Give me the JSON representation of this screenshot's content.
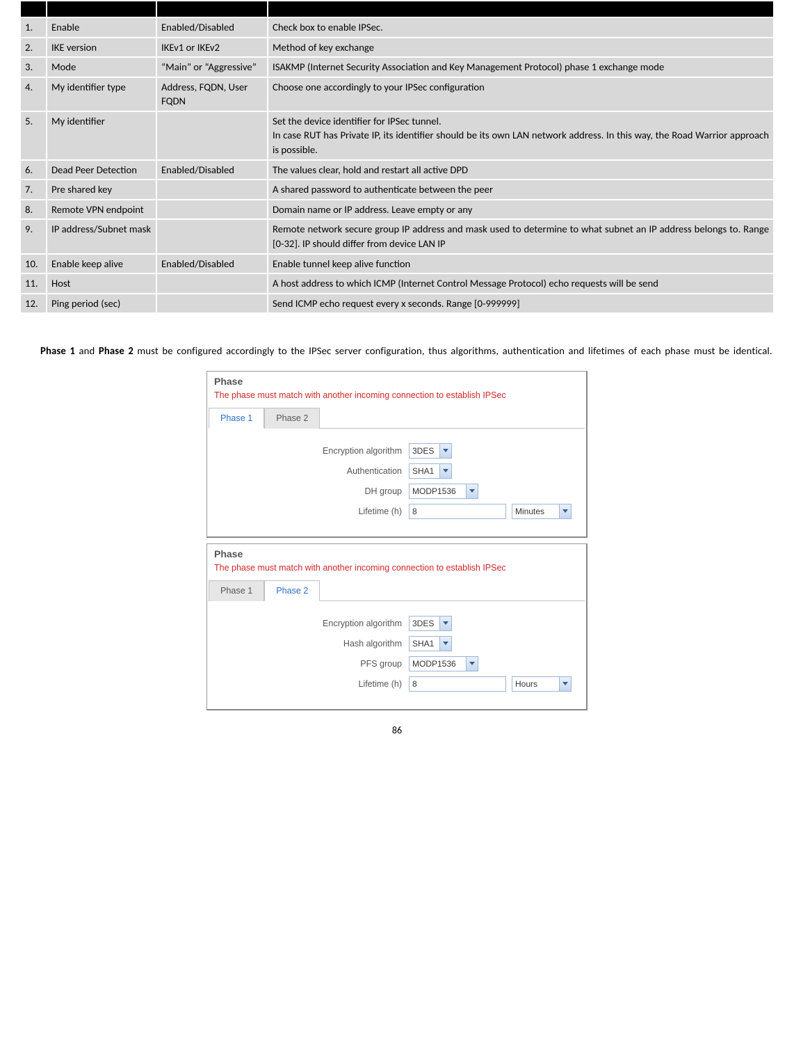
{
  "table": {
    "headers": [
      "",
      "",
      "",
      ""
    ],
    "rows": [
      {
        "n": "1.",
        "name": "Enable",
        "val": "Enabled/Disabled",
        "expl": "Check box to enable IPSec."
      },
      {
        "n": "2.",
        "name": "IKE version",
        "val": "IKEv1 or IKEv2",
        "expl": "Method of key exchange"
      },
      {
        "n": "3.",
        "name": "Mode",
        "val": "“Main” or “Aggressive”",
        "expl": "ISAKMP (Internet Security Association and Key Management Protocol) phase 1 exchange mode"
      },
      {
        "n": "4.",
        "name": "My identifier type",
        "val": "Address, FQDN, User FQDN",
        "expl": "Choose one accordingly to your IPSec configuration"
      },
      {
        "n": "5.",
        "name": "My identifier",
        "val": "",
        "expl": "Set the device identifier for IPSec tunnel.\nIn case RUT has Private IP, its identifier should be its own LAN network address. In this way, the Road Warrior approach is possible."
      },
      {
        "n": "6.",
        "name": "Dead Peer Detection",
        "val": "Enabled/Disabled",
        "expl": "The values clear, hold and restart all active DPD"
      },
      {
        "n": "7.",
        "name": "Pre shared key",
        "val": "",
        "expl": "A shared password to authenticate between the peer"
      },
      {
        "n": "8.",
        "name": "Remote VPN endpoint",
        "val": "",
        "expl": "Domain name or IP address. Leave empty or any"
      },
      {
        "n": "9.",
        "name": "IP address/Subnet mask",
        "val": "",
        "expl": "Remote network secure group IP address and mask used to determine to what subnet an IP address belongs to. Range [0-32]. IP should differ from device LAN IP"
      },
      {
        "n": "10.",
        "name": "Enable keep alive",
        "val": "Enabled/Disabled",
        "expl": "Enable tunnel keep alive function"
      },
      {
        "n": "11.",
        "name": "Host",
        "val": "",
        "expl": "A host address to which ICMP (Internet Control Message Protocol) echo requests will be send"
      },
      {
        "n": "12.",
        "name": "Ping period (sec)",
        "val": "",
        "expl": "Send ICMP echo request every x seconds.  Range [0-999999]"
      }
    ]
  },
  "paragraph": {
    "b1": "Phase 1",
    "mid1": " and ",
    "b2": "Phase 2",
    "rest": " must be configured accordingly to the IPSec server configuration, thus algorithms, authentication and lifetimes of each phase must be identical."
  },
  "panel": {
    "title": "Phase",
    "note": "The phase must match with another incoming connection to establish IPSec",
    "tabs": {
      "t1": "Phase 1",
      "t2": "Phase 2"
    }
  },
  "phase1": {
    "enc_label": "Encryption algorithm",
    "enc_val": "3DES",
    "auth_label": "Authentication",
    "auth_val": "SHA1",
    "dh_label": "DH group",
    "dh_val": "MODP1536",
    "life_label": "Lifetime (h)",
    "life_val": "8",
    "life_unit": "Minutes"
  },
  "phase2": {
    "enc_label": "Encryption algorithm",
    "enc_val": "3DES",
    "hash_label": "Hash algorithm",
    "hash_val": "SHA1",
    "pfs_label": "PFS group",
    "pfs_val": "MODP1536",
    "life_label": "Lifetime (h)",
    "life_val": "8",
    "life_unit": "Hours"
  },
  "pagenum": "86"
}
